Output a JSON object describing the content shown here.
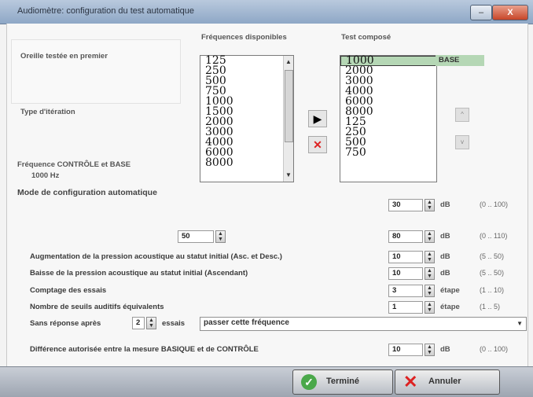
{
  "window": {
    "title": "Audiomètre: configuration du test automatique",
    "min_label": "–",
    "close_label": "X"
  },
  "left_panel": {
    "ear_label": "Oreille testée en premier",
    "iteration_label": "Type d'itération",
    "freq_label": "Fréquence CONTRÔLE et BASE",
    "freq_value": "1000 Hz"
  },
  "available": {
    "header": "Fréquences disponibles",
    "items": [
      "125",
      "250",
      "500",
      "750",
      "1000",
      "1500",
      "2000",
      "3000",
      "4000",
      "6000",
      "8000"
    ]
  },
  "composed": {
    "header": "Test composé",
    "items": [
      "1000",
      "2000",
      "3000",
      "4000",
      "6000",
      "8000",
      "125",
      "250",
      "500",
      "750"
    ],
    "base_label": "BASE"
  },
  "actions": {
    "add_glyph": "▶",
    "remove_glyph": "✕",
    "up_glyph": "^",
    "down_glyph": "v"
  },
  "auto_config": {
    "title": "Mode de configuration automatique",
    "row1": {
      "value": "30",
      "unit": "dB",
      "range": "(0 .. 100)"
    },
    "row2": {
      "left_value": "50",
      "value": "80",
      "unit": "dB",
      "range": "(0 .. 110)"
    },
    "rows": [
      {
        "label": "Augmentation de la pression acoustique au statut initial (Asc. et Desc.)",
        "value": "10",
        "unit": "dB",
        "range": "(5 .. 50)"
      },
      {
        "label": "Baisse de la pression acoustique au statut initial (Ascendant)",
        "value": "10",
        "unit": "dB",
        "range": "(5 .. 50)"
      },
      {
        "label": "Comptage des essais",
        "value": "3",
        "unit": "étape",
        "range": "(1 .. 10)"
      },
      {
        "label": "Nombre de seuils auditifs équivalents",
        "value": "1",
        "unit": "étape",
        "range": "(1 .. 5)"
      }
    ],
    "no_response": {
      "prefix": "Sans réponse après",
      "count": "2",
      "suffix": "essais",
      "selected": "passer cette fréquence"
    },
    "diff": {
      "label": "Différence autorisée entre la mesure BASIQUE et de CONTRÔLE",
      "value": "10",
      "unit": "dB",
      "range": "(0 .. 100)"
    }
  },
  "footer": {
    "done_label": "Terminé",
    "cancel_label": "Annuler"
  }
}
